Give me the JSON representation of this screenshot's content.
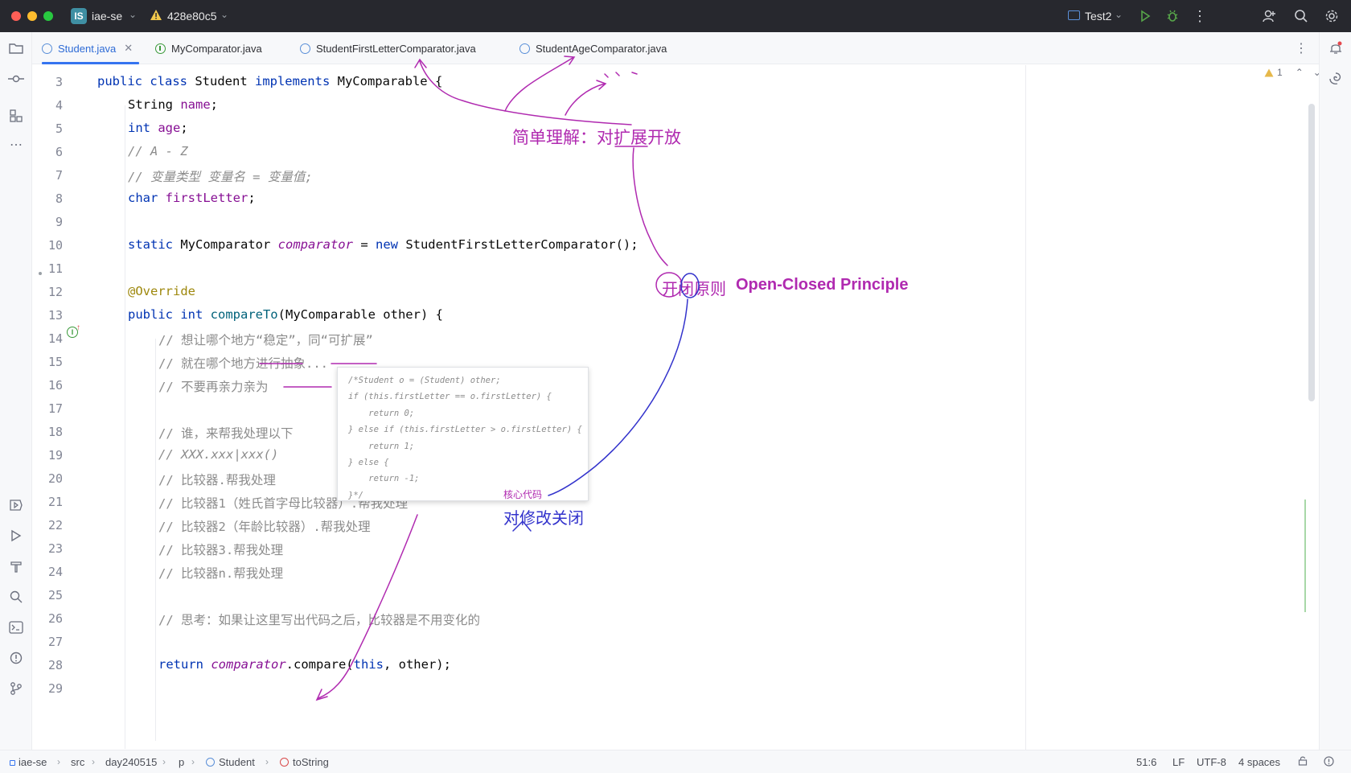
{
  "window": {
    "project_badge": "IS",
    "project_name": "iae-se",
    "branch": "428e80c5",
    "run_config": "Test2"
  },
  "tabs": [
    {
      "label": "Student.java",
      "kind": "class",
      "active": true
    },
    {
      "label": "MyComparator.java",
      "kind": "interface",
      "active": false
    },
    {
      "label": "StudentFirstLetterComparator.java",
      "kind": "class",
      "active": false
    },
    {
      "label": "StudentAgeComparator.java",
      "kind": "class",
      "active": false
    }
  ],
  "inspection": {
    "warnings": "1"
  },
  "gutter": {
    "line_numbers": [
      "3",
      "4",
      "5",
      "6",
      "7",
      "8",
      "9",
      "10",
      "11",
      "12",
      "13",
      "14",
      "15",
      "16",
      "17",
      "18",
      "19",
      "20",
      "21",
      "22",
      "23",
      "24",
      "25",
      "26",
      "27",
      "28",
      "29"
    ]
  },
  "code": {
    "l3": {
      "kw1": "public class ",
      "name": "Student ",
      "kw2": "implements ",
      "iface": "MyComparable {"
    },
    "l4": {
      "type": "String ",
      "field": "name",
      "end": ";"
    },
    "l5": {
      "type": "int ",
      "field": "age",
      "end": ";"
    },
    "l6": {
      "comment": "// A - Z"
    },
    "l7": {
      "comment": "// 变量类型 变量名 = 变量值;"
    },
    "l8": {
      "type": "char ",
      "field": "firstLetter",
      "end": ";"
    },
    "l10": {
      "kw": "static ",
      "type": "MyComparator ",
      "field": "comparator",
      "op": " = ",
      "kwnew": "new ",
      "rest": "StudentFirstLetterComparator();"
    },
    "l12": {
      "annotation": "@Override"
    },
    "l13": {
      "kw": "public int ",
      "method": "compareTo",
      "rest": "(MyComparable other) {"
    },
    "l14": {
      "comment": "// 想让哪个地方“稳定”，同“可扩展”"
    },
    "l15": {
      "comment": "// 就在哪个地方进行抽象..."
    },
    "l16": {
      "comment": "// 不要再亲力亲为"
    },
    "l18": {
      "comment": "// 谁，来帮我处理以下"
    },
    "l19": {
      "comment": "// XXX.xxx|xxx()"
    },
    "l20": {
      "comment": "// 比较器.帮我处理"
    },
    "l21": {
      "comment": "// 比较器1（姓氏首字母比较器）.帮我处理"
    },
    "l22": {
      "comment": "// 比较器2（年龄比较器）.帮我处理"
    },
    "l23": {
      "comment": "// 比较器3.帮我处理"
    },
    "l24": {
      "comment": "// 比较器n.帮我处理"
    },
    "l26": {
      "comment": "// 思考：如果让这里写出代码之后，比较器是不用变化的"
    },
    "l28": {
      "kw": "return ",
      "field": "comparator",
      "call": ".compare(",
      "kwthis": "this",
      "rest": ", other);"
    }
  },
  "snippet": {
    "lines": [
      "/*Student o = (Student) other;",
      "if (this.firstLetter == o.firstLetter) {",
      "    return 0;",
      "} else if (this.firstLetter > o.firstLetter) {",
      "    return 1;",
      "} else {",
      "    return -1;",
      "}*/"
    ]
  },
  "annotations": {
    "extension_open": "简单理解：对扩展开放",
    "ocp_cn": "开闭原则",
    "ocp_en": "Open-Closed Principle",
    "core_code": "核心代码",
    "modification_closed": "对修改关闭"
  },
  "statusbar": {
    "breadcrumbs": [
      "iae-se",
      "src",
      "day240515",
      "p",
      "Student",
      "toString"
    ],
    "position": "51:6",
    "line_sep": "LF",
    "encoding": "UTF-8",
    "indent": "4 spaces"
  },
  "colors": {
    "accent": "#3574f0",
    "annotation_purple": "#b02ab0",
    "annotation_blue": "#3333cc"
  }
}
